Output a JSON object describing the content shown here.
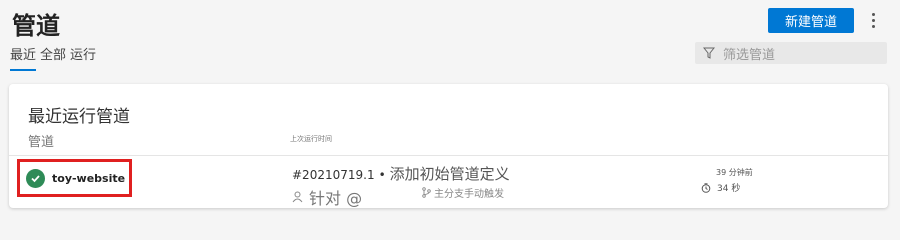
{
  "header": {
    "title": "管道",
    "new_button_label": "新建管道"
  },
  "tabs": [
    {
      "label": "最近"
    },
    {
      "label": "全部"
    },
    {
      "label": "运行"
    }
  ],
  "filter": {
    "placeholder": "筛选管道"
  },
  "card": {
    "title": "最近运行管道",
    "column_pipeline": "管道",
    "column_last_run": "上次运行时间"
  },
  "pipeline_row": {
    "name": "toy-website",
    "status": "succeeded",
    "run_id": "#20210719.1",
    "separator": "•",
    "commit_message": "添加初始管道定义",
    "triggered_by": "针对 @",
    "branch_label": "主分支手动触发",
    "time_ago": "39 分钟前",
    "duration": "34 秒"
  },
  "colors": {
    "accent": "#0078d4",
    "success": "#2e8b57",
    "highlight_border": "#e02020"
  }
}
